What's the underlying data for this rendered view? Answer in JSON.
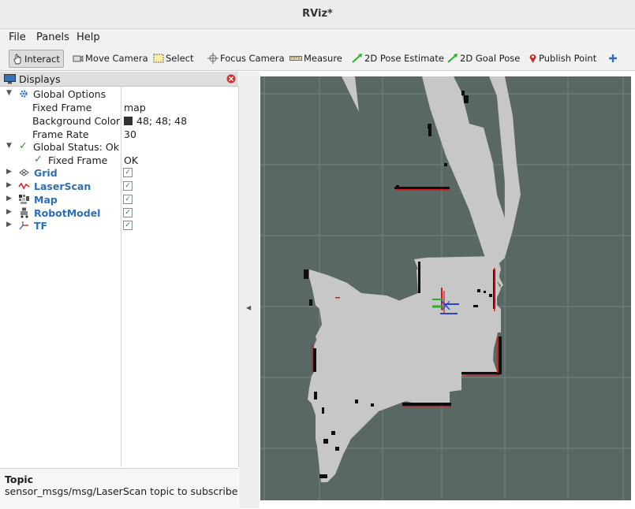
{
  "window": {
    "title": "RViz*"
  },
  "menu": {
    "file": "File",
    "panels": "Panels",
    "help": "Help"
  },
  "toolbar": {
    "interact": "Interact",
    "move_camera": "Move Camera",
    "select": "Select",
    "focus_camera": "Focus Camera",
    "measure": "Measure",
    "pose_estimate": "2D Pose Estimate",
    "goal_pose": "2D Goal Pose",
    "publish_point": "Publish Point"
  },
  "displays": {
    "header": "Displays",
    "global_options": {
      "label": "Global Options",
      "fixed_frame_label": "Fixed Frame",
      "fixed_frame_value": "map",
      "bg_color_label": "Background Color",
      "bg_color_value": "48; 48; 48",
      "frame_rate_label": "Frame Rate",
      "frame_rate_value": "30"
    },
    "global_status": {
      "label": "Global Status: Ok",
      "fixed_frame_label": "Fixed Frame",
      "fixed_frame_value": "OK"
    },
    "items": [
      {
        "label": "Grid",
        "icon": "grid-icon",
        "enabled": true
      },
      {
        "label": "LaserScan",
        "icon": "laserscan-icon",
        "enabled": true
      },
      {
        "label": "Map",
        "icon": "map-icon",
        "enabled": true
      },
      {
        "label": "RobotModel",
        "icon": "robot-model-icon",
        "enabled": true
      },
      {
        "label": "TF",
        "icon": "tf-icon",
        "enabled": true
      }
    ]
  },
  "topic_help": {
    "title": "Topic",
    "text": "sensor_msgs/msg/LaserScan topic to subscribe"
  },
  "colors": {
    "viewport_bg": "#5a6865",
    "map_free": "#c7c7c7",
    "obstacle": "#0e0e0e",
    "laser": "#d11a1a",
    "link_blue": "#2c6fb6"
  }
}
